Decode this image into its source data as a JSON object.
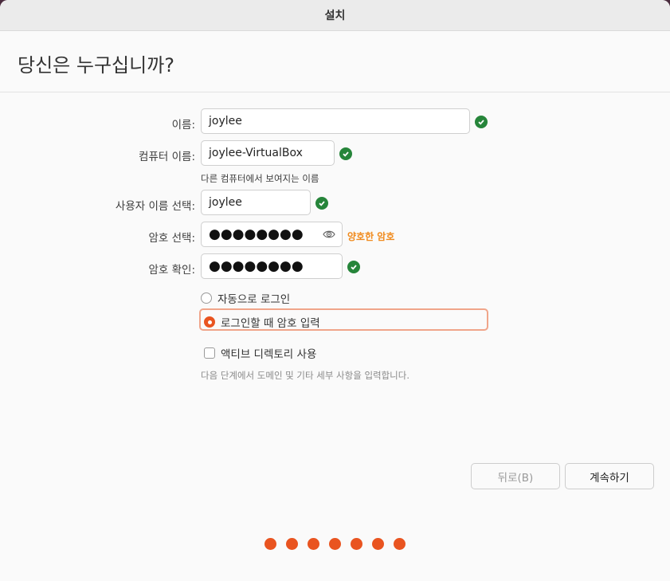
{
  "window": {
    "title": "설치"
  },
  "page": {
    "heading": "당신은 누구십니까?"
  },
  "form": {
    "name": {
      "label": "이름:",
      "value": "joylee"
    },
    "computer_name": {
      "label": "컴퓨터 이름:",
      "value": "joylee-VirtualBox",
      "hint": "다른 컴퓨터에서 보여지는 이름"
    },
    "username": {
      "label": "사용자 이름 선택:",
      "value": "joylee"
    },
    "password": {
      "label": "암호 선택:",
      "value": "●●●●●●●●",
      "strength": "양호한 암호"
    },
    "confirm_password": {
      "label": "암호 확인:",
      "value": "●●●●●●●●"
    },
    "login_options": [
      {
        "label": "자동으로 로그인",
        "selected": false
      },
      {
        "label": "로그인할 때 암호 입력",
        "selected": true
      }
    ],
    "active_directory": {
      "label": "액티브 디렉토리 사용",
      "checked": false,
      "hint": "다음 단계에서 도메인 및 기타 세부 사항을 입력합니다."
    }
  },
  "buttons": {
    "back": "뒤로(B)",
    "continue": "계속하기"
  },
  "progress": {
    "total_steps": 7,
    "accent": "#e95420"
  },
  "icons": {
    "valid": "check-circle-icon",
    "reveal": "eye-icon"
  }
}
